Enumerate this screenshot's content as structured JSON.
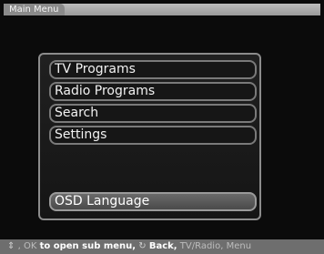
{
  "window": {
    "title": "Main Menu"
  },
  "menu": {
    "items": [
      {
        "label": "TV Programs"
      },
      {
        "label": "Radio Programs"
      },
      {
        "label": "Search"
      },
      {
        "label": "Settings"
      },
      {
        "label": "OSD Language"
      }
    ]
  },
  "footer": {
    "arrows_icon": "up-down-arrows-icon",
    "sep": ",",
    "ok_key": "OK",
    "ok_text": "to open sub menu,",
    "back_icon": "back-icon",
    "back_text": "Back,",
    "tvradio_text": "TV/Radio,",
    "menu_text": "Menu"
  }
}
